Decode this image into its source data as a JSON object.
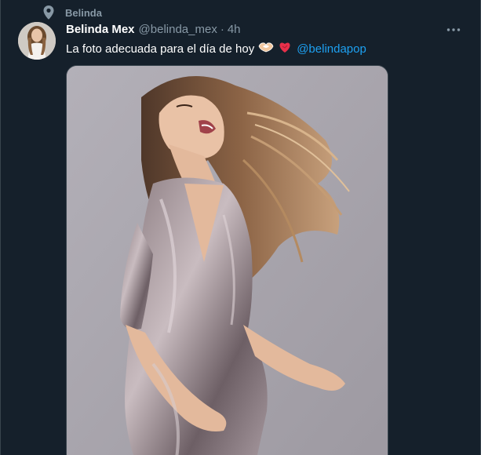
{
  "context": {
    "label": "Belinda",
    "icon": "location-pin-icon"
  },
  "tweet": {
    "display_name": "Belinda Mex",
    "handle": "@belinda_mex",
    "separator": "·",
    "time": "4h",
    "text": "La foto adecuada para el día de hoy",
    "emojis": [
      "handshake-heart-icon",
      "heart-icon"
    ],
    "mention": "@belindapop",
    "more_icon": "more-options-icon"
  },
  "colors": {
    "background": "#15202b",
    "text_primary": "#ffffff",
    "text_secondary": "#8899a6",
    "link": "#1da1f2",
    "border": "#38444d"
  }
}
